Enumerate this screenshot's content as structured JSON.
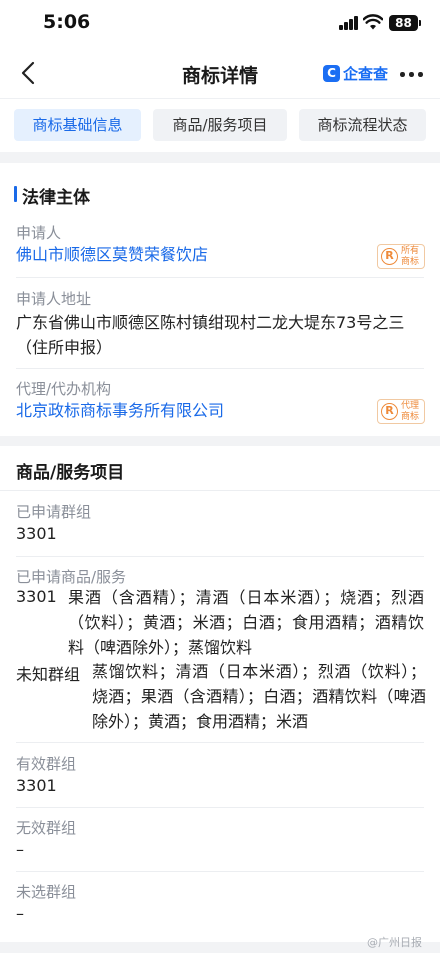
{
  "status_bar": {
    "time": "5:06",
    "battery": "88"
  },
  "nav": {
    "title": "商标详情",
    "brand_logo": "C",
    "brand_name": "企查查"
  },
  "tabs": [
    {
      "label": "商标基础信息",
      "active": true
    },
    {
      "label": "商品/服务项目",
      "active": false
    },
    {
      "label": "商标流程状态",
      "active": false
    }
  ],
  "legal": {
    "title": "法律主体",
    "applicant_label": "申请人",
    "applicant_value": "佛山市顺德区莫赞荣餐饮店",
    "applicant_badge": "所有商标",
    "address_label": "申请人地址",
    "address_value": "广东省佛山市顺德区陈村镇绀现村二龙大堤东73号之三（住所申报）",
    "agent_label": "代理/代办机构",
    "agent_value": "北京政标商标事务所有限公司",
    "agent_badge": "代理商标"
  },
  "goods": {
    "title": "商品/服务项目",
    "applied_group_label": "已申请群组",
    "applied_group_value": "3301",
    "applied_goods_label": "已申请商品/服务",
    "items": [
      {
        "group": "3301",
        "text": "果酒（含酒精）；清酒（日本米酒）；烧酒；烈酒（饮料）；黄酒；米酒；白酒；食用酒精；酒精饮料（啤酒除外）；蒸馏饮料"
      },
      {
        "group": "未知群组",
        "text": "蒸馏饮料；清酒（日本米酒）；烈酒（饮料）；烧酒；果酒（含酒精）；白酒；酒精饮料（啤酒除外）；黄酒；食用酒精；米酒"
      }
    ],
    "valid_group_label": "有效群组",
    "valid_group_value": "3301",
    "invalid_group_label": "无效群组",
    "invalid_group_value": "–",
    "unselected_group_label": "未选群组",
    "unselected_group_value": "–"
  },
  "watermark": "@广州日报",
  "colors": {
    "accent": "#1a6ae8",
    "badge": "#ee8a3a"
  }
}
